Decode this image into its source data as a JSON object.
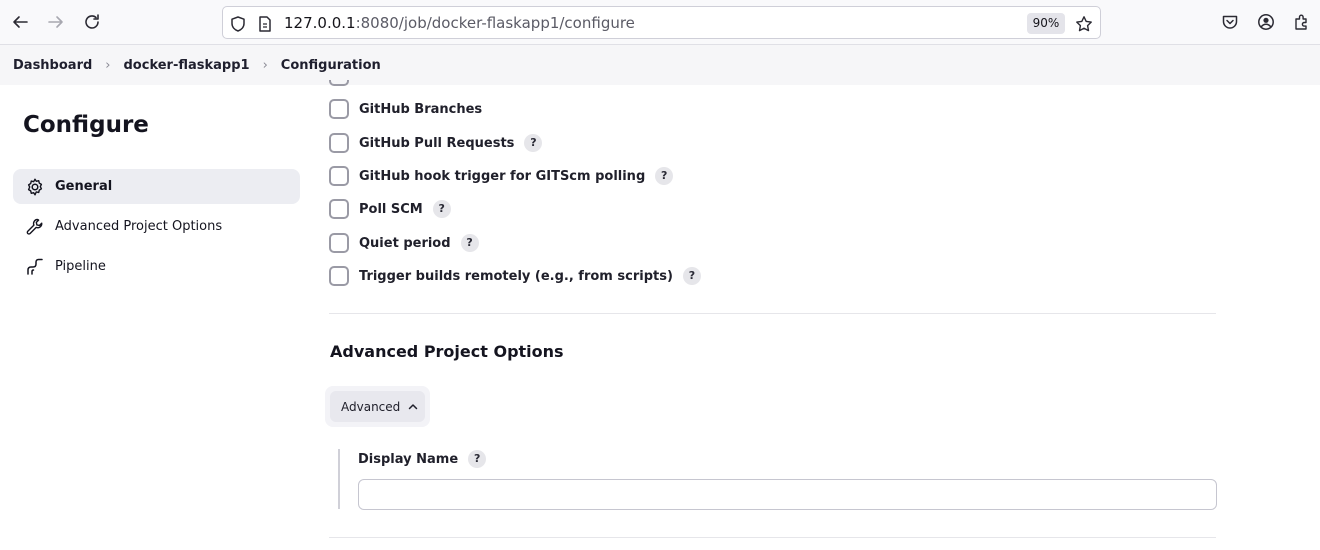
{
  "browser": {
    "url_host": "127.0.0.1",
    "url_path": ":8080/job/docker-flaskapp1/configure",
    "zoom": "90%"
  },
  "breadcrumb": [
    "Dashboard",
    "docker-flaskapp1",
    "Configuration"
  ],
  "sidebar": {
    "title": "Configure",
    "items": [
      {
        "label": "General",
        "icon": "gear-icon",
        "active": true
      },
      {
        "label": "Advanced Project Options",
        "icon": "wrench-icon",
        "active": false
      },
      {
        "label": "Pipeline",
        "icon": "pipeline-icon",
        "active": false
      }
    ]
  },
  "triggers": [
    {
      "label": "GitHub Branches",
      "checked": false,
      "help": false
    },
    {
      "label": "GitHub Pull Requests",
      "checked": false,
      "help": true
    },
    {
      "label": "GitHub hook trigger for GITScm polling",
      "checked": false,
      "help": true
    },
    {
      "label": "Poll SCM",
      "checked": false,
      "help": true
    },
    {
      "label": "Quiet period",
      "checked": false,
      "help": true
    },
    {
      "label": "Trigger builds remotely (e.g., from scripts)",
      "checked": false,
      "help": true
    }
  ],
  "help_glyph": "?",
  "advanced_section": {
    "title": "Advanced Project Options",
    "button_label": "Advanced",
    "display_name": {
      "label": "Display Name",
      "value": ""
    }
  }
}
